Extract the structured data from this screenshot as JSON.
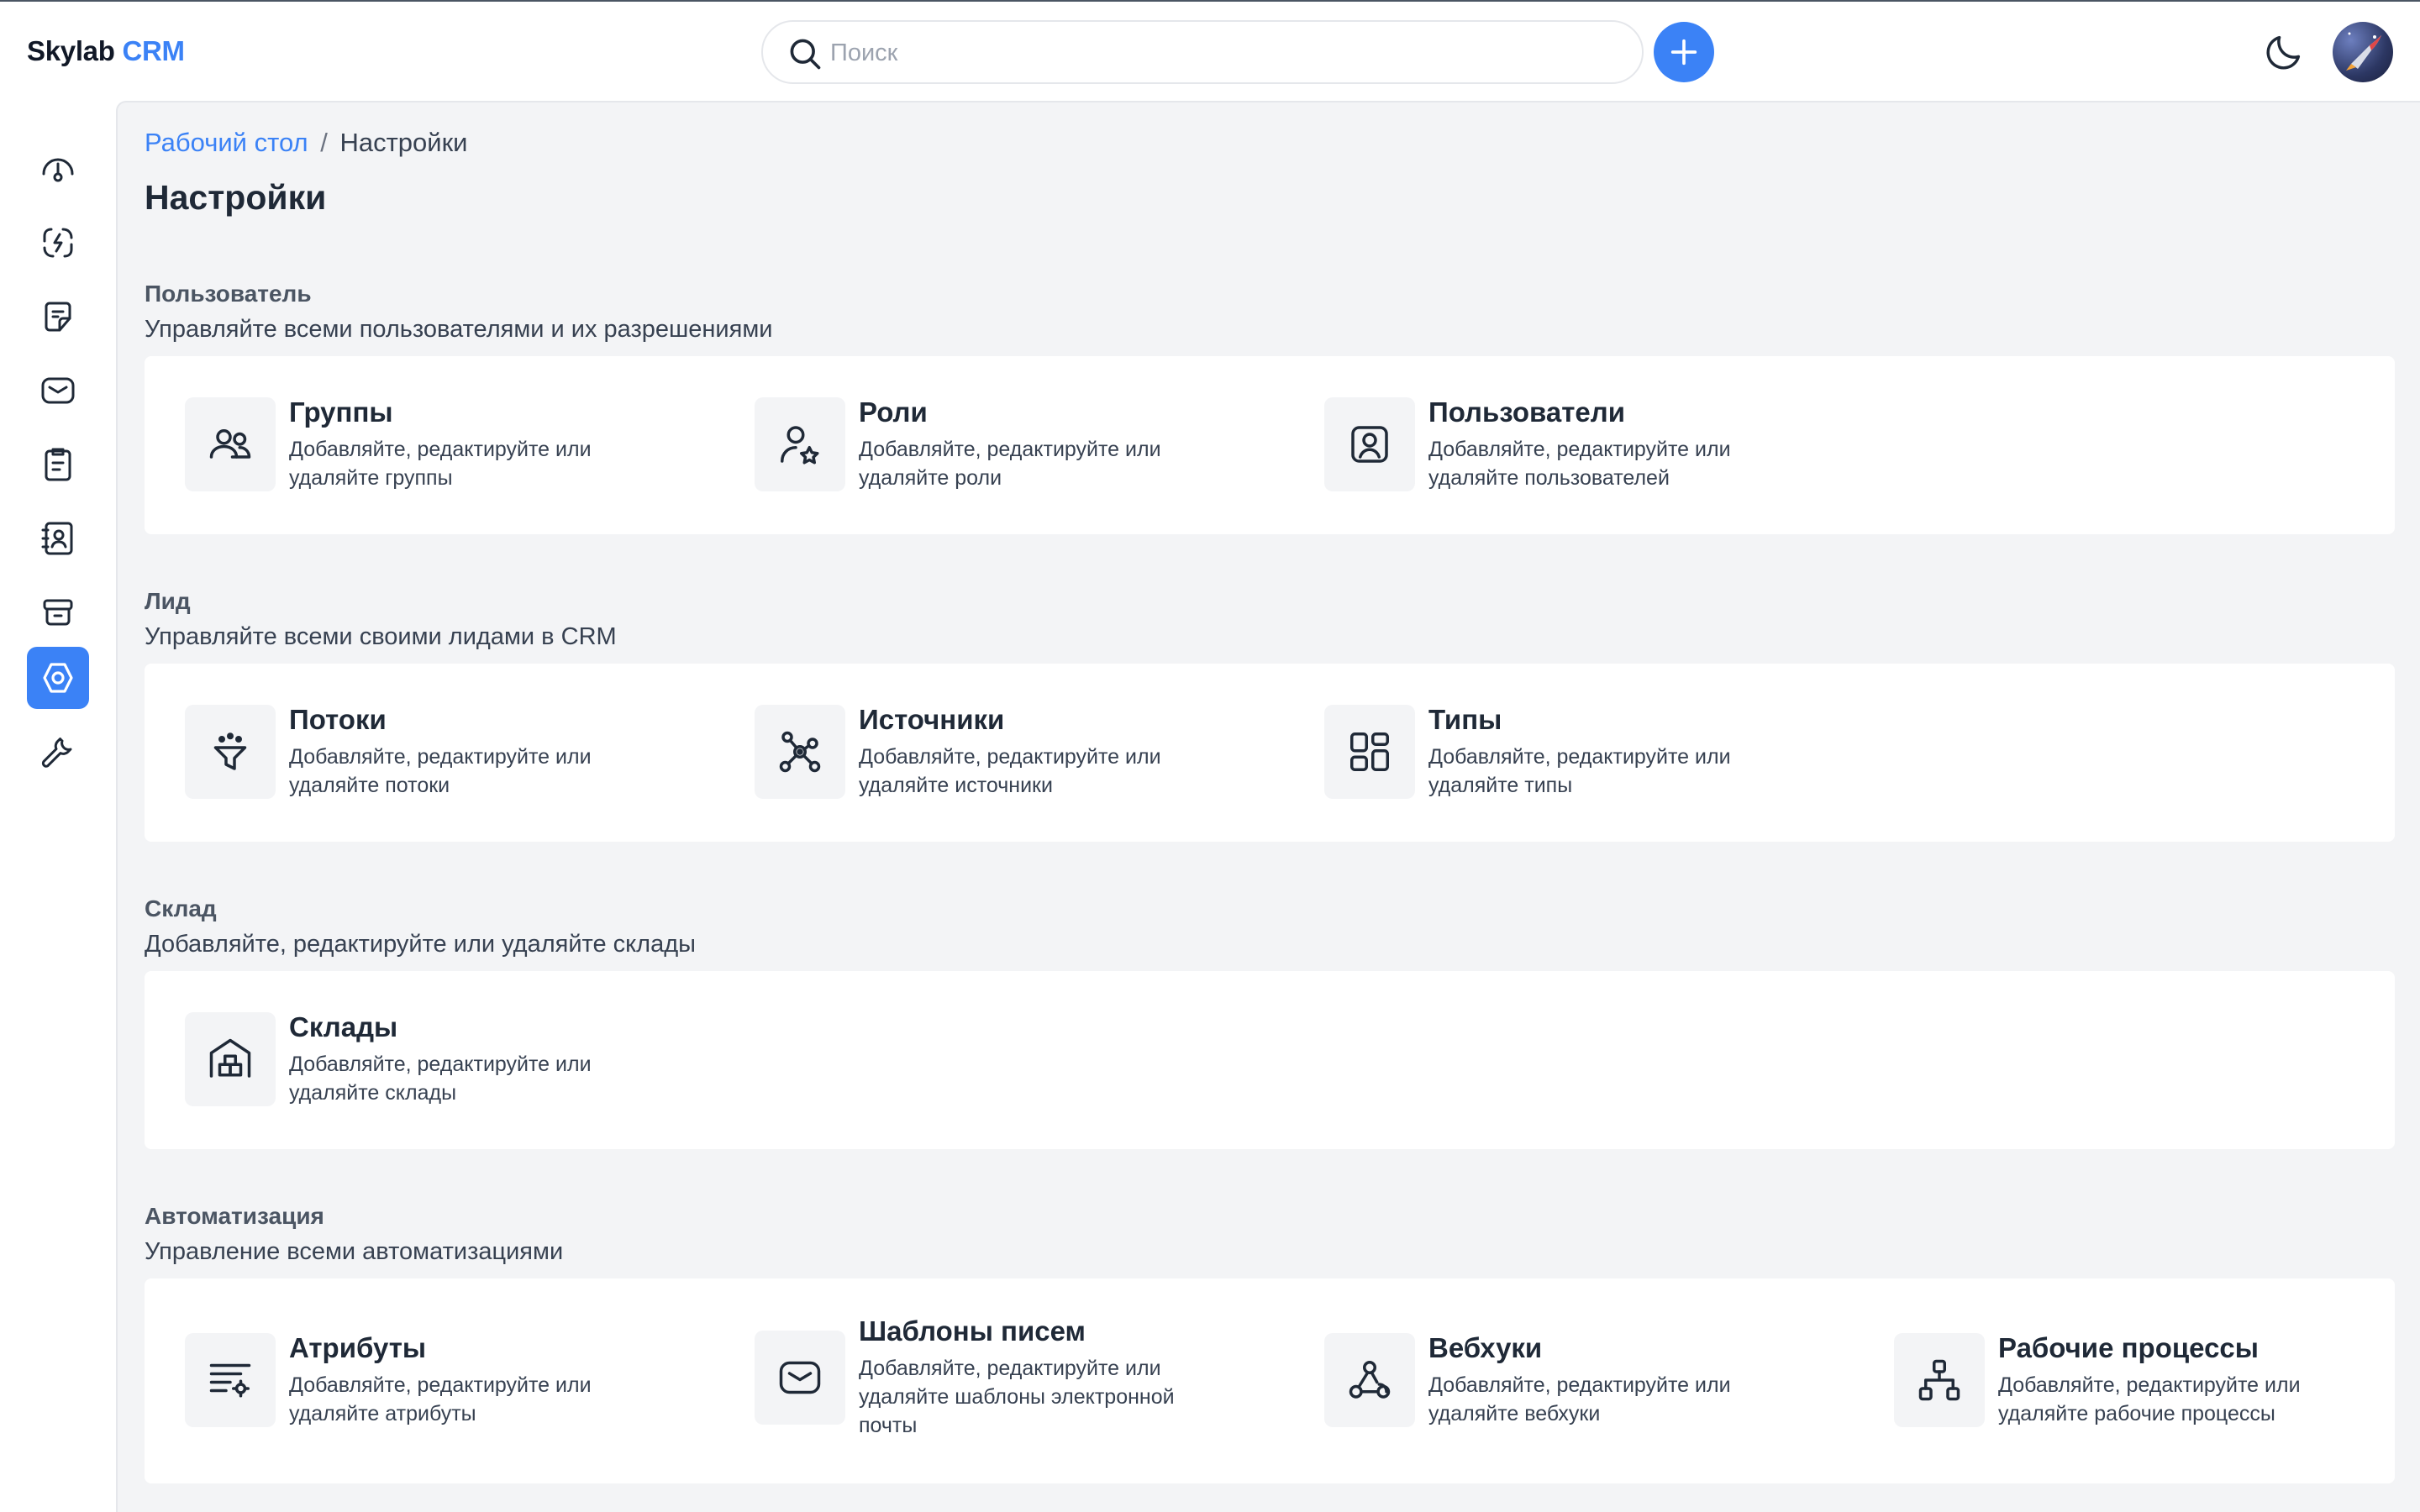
{
  "header": {
    "logo_brand": "Skylab",
    "logo_accent": "CRM",
    "search_placeholder": "Поиск",
    "accent_color": "#3b82f6"
  },
  "sidebar": {
    "items": [
      {
        "icon": "dashboard-gauge-icon",
        "active": false
      },
      {
        "icon": "leads-exchange-icon",
        "active": false
      },
      {
        "icon": "quotes-note-icon",
        "active": false
      },
      {
        "icon": "mail-icon",
        "active": false
      },
      {
        "icon": "activities-clipboard-icon",
        "active": false
      },
      {
        "icon": "contacts-book-icon",
        "active": false
      },
      {
        "icon": "products-box-icon",
        "active": false
      },
      {
        "icon": "settings-gear-icon",
        "active": true
      },
      {
        "icon": "tools-wrench-icon",
        "active": false
      }
    ]
  },
  "breadcrumb": {
    "home": "Рабочий стол",
    "separator": "/",
    "current": "Настройки"
  },
  "page_title": "Настройки",
  "sections": [
    {
      "title": "Пользователь",
      "subtitle": "Управляйте всеми пользователями и их разрешениями",
      "tiles": [
        {
          "title": "Группы",
          "desc1": "Добавляйте, редактируйте или",
          "desc2": "удаляйте группы",
          "desc3": "",
          "icon": "groups-icon"
        },
        {
          "title": "Роли",
          "desc1": "Добавляйте, редактируйте или",
          "desc2": "удаляйте роли",
          "desc3": "",
          "icon": "roles-icon"
        },
        {
          "title": "Пользователи",
          "desc1": "Добавляйте, редактируйте или",
          "desc2": "удаляйте пользователей",
          "desc3": "",
          "icon": "users-icon"
        }
      ]
    },
    {
      "title": "Лид",
      "subtitle": "Управляйте всеми своими лидами в CRM",
      "tiles": [
        {
          "title": "Потоки",
          "desc1": "Добавляйте, редактируйте или",
          "desc2": "удаляйте потоки",
          "desc3": "",
          "icon": "pipelines-funnel-icon"
        },
        {
          "title": "Источники",
          "desc1": "Добавляйте, редактируйте или",
          "desc2": "удаляйте источники",
          "desc3": "",
          "icon": "sources-icon"
        },
        {
          "title": "Типы",
          "desc1": "Добавляйте, редактируйте или",
          "desc2": "удаляйте типы",
          "desc3": "",
          "icon": "types-grid-icon"
        }
      ]
    },
    {
      "title": "Склад",
      "subtitle": "Добавляйте, редактируйте или удаляйте склады",
      "tiles": [
        {
          "title": "Склады",
          "desc1": "Добавляйте, редактируйте или",
          "desc2": "удаляйте склады",
          "desc3": "",
          "icon": "warehouse-icon"
        }
      ]
    },
    {
      "title": "Автоматизация",
      "subtitle": "Управление всеми автоматизациями",
      "tiles": [
        {
          "title": "Атрибуты",
          "desc1": "Добавляйте, редактируйте или",
          "desc2": "удаляйте атрибуты",
          "desc3": "",
          "icon": "attributes-icon"
        },
        {
          "title": "Шаблоны писем",
          "desc1": "Добавляйте, редактируйте или",
          "desc2": "удаляйте шаблоны электронной",
          "desc3": "почты",
          "icon": "email-template-icon"
        },
        {
          "title": "Вебхуки",
          "desc1": "Добавляйте, редактируйте или",
          "desc2": "удаляйте вебхуки",
          "desc3": "",
          "icon": "webhooks-icon"
        },
        {
          "title": "Рабочие процессы",
          "desc1": "Добавляйте, редактируйте или",
          "desc2": "удаляйте рабочие процессы",
          "desc3": "",
          "icon": "workflows-icon"
        }
      ]
    }
  ]
}
